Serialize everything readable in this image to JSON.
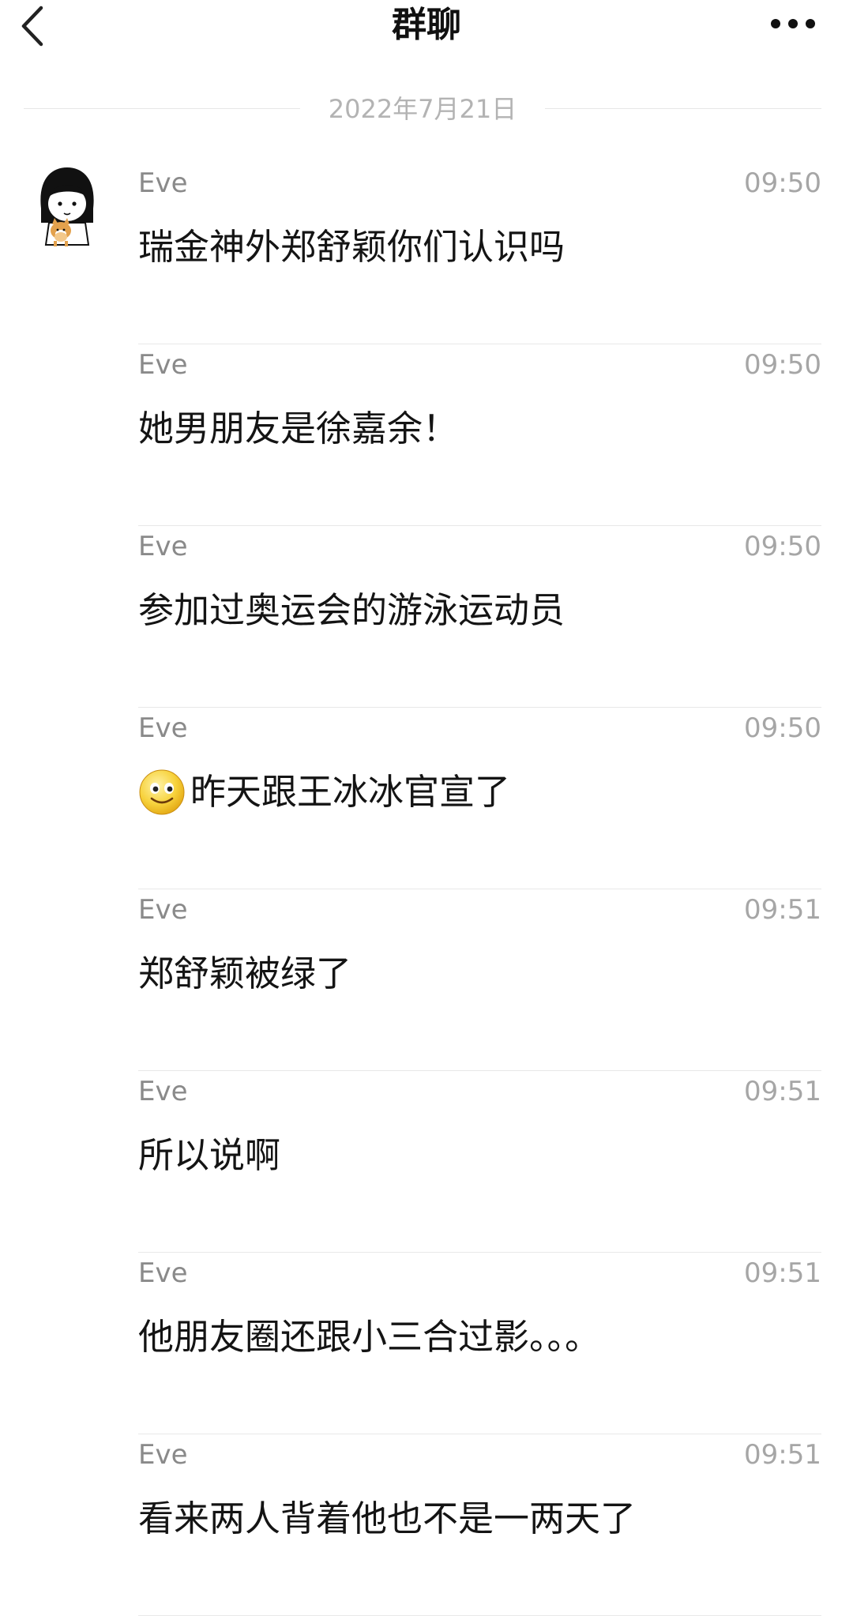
{
  "header": {
    "title": "群聊",
    "back_icon": "chevron-left-icon",
    "more_icon": "more-horizontal-icon"
  },
  "date_separator": "2022年7月21日",
  "messages": [
    {
      "sender": "Eve",
      "time": "09:50",
      "text": "瑞金神外郑舒颖你们认识吗"
    },
    {
      "sender": "Eve",
      "time": "09:50",
      "text": "她男朋友是徐嘉余！"
    },
    {
      "sender": "Eve",
      "time": "09:50",
      "text": "参加过奥运会的游泳运动员"
    },
    {
      "sender": "Eve",
      "time": "09:50",
      "text": "昨天跟王冰冰官宣了",
      "emoji": "smile-emoji-icon"
    },
    {
      "sender": "Eve",
      "time": "09:51",
      "text": "郑舒颖被绿了"
    },
    {
      "sender": "Eve",
      "time": "09:51",
      "text": "所以说啊"
    },
    {
      "sender": "Eve",
      "time": "09:51",
      "text": "他朋友圈还跟小三合过影。。。"
    },
    {
      "sender": "Eve",
      "time": "09:51",
      "text": "看来两人背着他也不是一两天了"
    }
  ],
  "colors": {
    "sender": "#8a8a8a",
    "time": "#a6a6a6",
    "divider": "#e8e8e8",
    "text": "#141414"
  }
}
